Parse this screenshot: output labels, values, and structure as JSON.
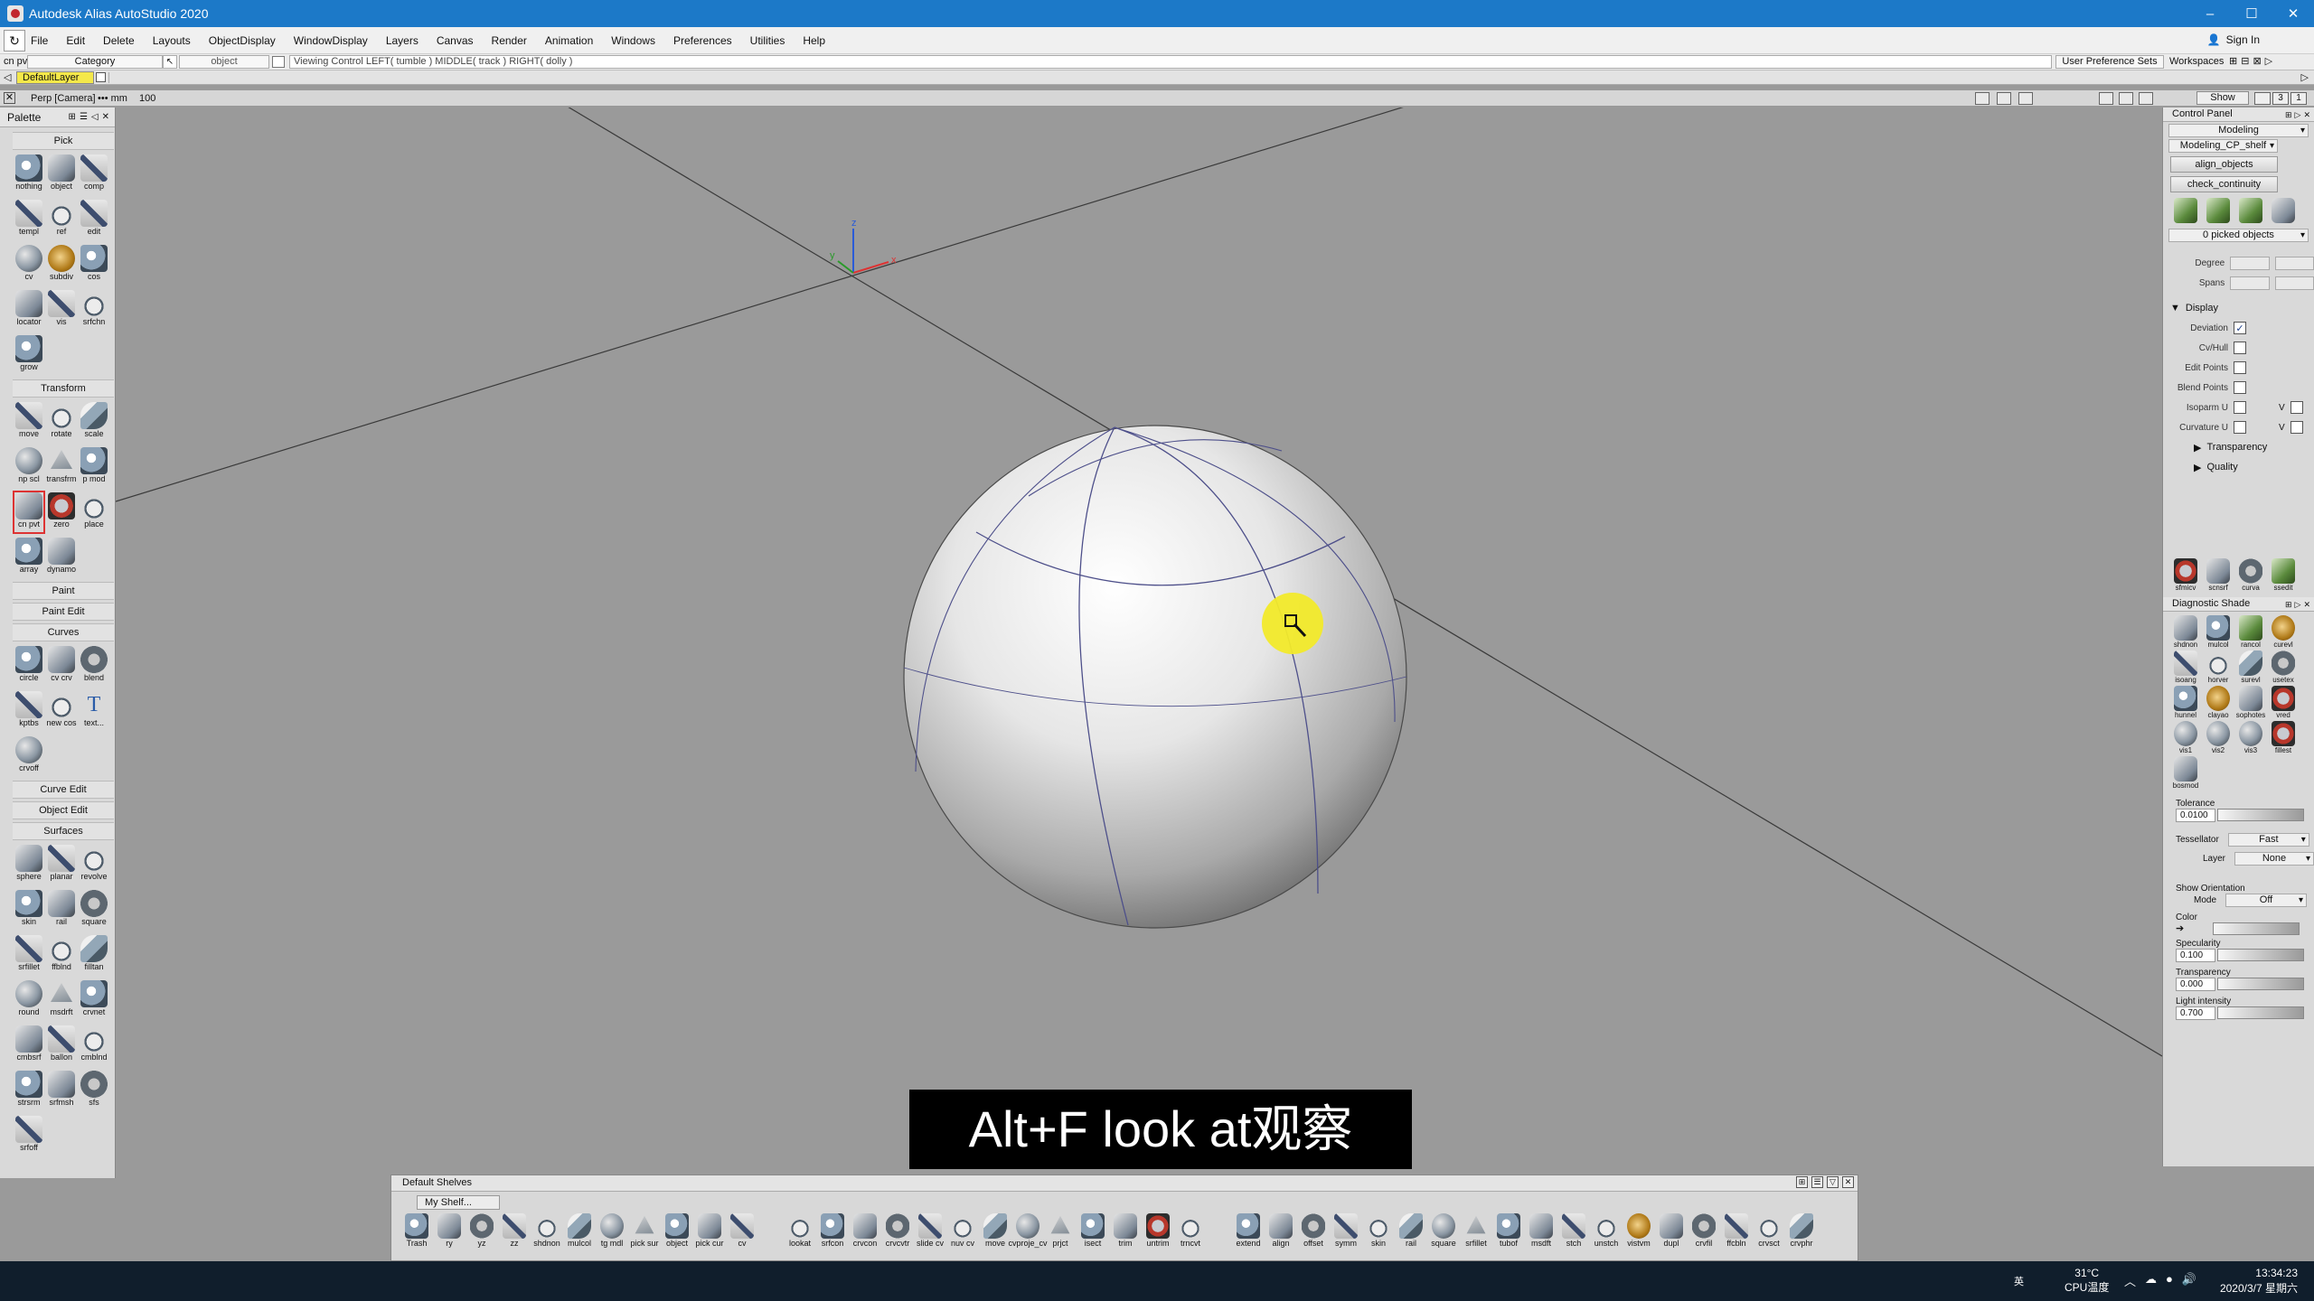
{
  "window": {
    "title": "Autodesk Alias AutoStudio 2020",
    "minimize": "–",
    "maximize": "☐",
    "close": "✕"
  },
  "menubar": {
    "items": [
      "File",
      "Edit",
      "Delete",
      "Layouts",
      "ObjectDisplay",
      "WindowDisplay",
      "Layers",
      "Canvas",
      "Render",
      "Animation",
      "Windows",
      "Preferences",
      "Utilities",
      "Help"
    ],
    "sign_in": "Sign In"
  },
  "controlbar": {
    "current_tool": "cn pvt",
    "category": "Category",
    "pick_mode": "object",
    "viewing_control": "Viewing Control   LEFT( tumble )   MIDDLE( track )   RIGHT( dolly )",
    "user_preference_sets": "User Preference Sets",
    "workspaces": "Workspaces"
  },
  "layerbar": {
    "default_layer": "DefaultLayer",
    "default_layer_color": "#f4e84a"
  },
  "viewbar": {
    "camera": "Perp [Camera]",
    "units": "••• mm",
    "zoom": "100",
    "show": "Show",
    "quick_views": [
      "1",
      "3"
    ]
  },
  "palette": {
    "title": "Palette",
    "sections": [
      {
        "name": "Pick",
        "tools": [
          "nothing",
          "object",
          "comp",
          "templ",
          "ref",
          "edit",
          "cv",
          "subdiv",
          "cos",
          "locator",
          "vis",
          "srfchn",
          "grow"
        ]
      },
      {
        "name": "Transform",
        "tools": [
          "move",
          "rotate",
          "scale",
          "np scl",
          "transfrm",
          "p mod",
          "cn pvt",
          "zero",
          "place",
          "array",
          "dynamo"
        ]
      },
      {
        "name": "Paint",
        "tools": []
      },
      {
        "name": "Paint Edit",
        "tools": []
      },
      {
        "name": "Curves",
        "tools": [
          "circle",
          "cv crv",
          "blend",
          "kptbs",
          "new cos",
          "text...",
          "crvoff"
        ]
      },
      {
        "name": "Curve Edit",
        "tools": []
      },
      {
        "name": "Object Edit",
        "tools": []
      },
      {
        "name": "Surfaces",
        "tools": [
          "sphere",
          "planar",
          "revolve",
          "skin",
          "rail",
          "square",
          "srfillet",
          "ffblnd",
          "filltan",
          "round",
          "msdrft",
          "crvnet",
          "cmbsrf",
          "ballon",
          "cmblnd",
          "strsrm",
          "srfmsh",
          "sfs",
          "srfoff"
        ]
      }
    ],
    "selected_tool": "cn pvt"
  },
  "viewport": {
    "background": "#9a9a9a",
    "axis_labels": {
      "x": "x",
      "y": "y",
      "z": "z"
    }
  },
  "subtitle": {
    "text": "Alt+F   look at观察"
  },
  "shelf": {
    "title": "Default Shelves",
    "tab": "My Shelf...",
    "tools": [
      "Trash",
      "ry",
      "yz",
      "zz",
      "shdnon",
      "mulcol",
      "tg mdl",
      "pick sur",
      "object",
      "pick cur",
      "cv",
      "lookat",
      "srfcon",
      "crvcon",
      "crvcvtr",
      "slide cv",
      "nuv cv",
      "move",
      "cvproje_cv",
      "prjct",
      "isect",
      "trim",
      "untrim",
      "trncvt",
      "extend",
      "align",
      "offset",
      "symm",
      "skin",
      "rail",
      "square",
      "srfillet",
      "tubof",
      "msdft",
      "stch",
      "unstch",
      "vistvm",
      "dupl",
      "crvfil",
      "ffcbln",
      "crvsct",
      "crvphr"
    ]
  },
  "control_panel": {
    "title": "Control Panel",
    "mode": "Modeling",
    "shelf": "Modeling_CP_shelf",
    "align_button": "align_objects",
    "check_button": "check_continuity",
    "picked": "0 picked objects",
    "degree_label": "Degree",
    "spans_label": "Spans",
    "display_section": "Display",
    "display_items": [
      {
        "label": "Deviation",
        "checked": true
      },
      {
        "label": "Cv/Hull",
        "checked": false
      },
      {
        "label": "Edit Points",
        "checked": false
      },
      {
        "label": "Blend Points",
        "checked": false
      },
      {
        "label": "Isoparm U",
        "checked": false,
        "v": "V"
      },
      {
        "label": "Curvature U",
        "checked": false,
        "v": "V"
      }
    ],
    "transparency_section": "Transparency",
    "quality_section": "Quality",
    "bottom_tools": [
      "sfmicv",
      "scnsrf",
      "curva",
      "ssedit"
    ],
    "diag_title": "Diagnostic Shade",
    "diag_tools": [
      "shdnon",
      "mulcol",
      "rancol",
      "curevl",
      "isoang",
      "horver",
      "surevl",
      "usetex",
      "hunnel",
      "clayao",
      "sophotes",
      "vred",
      "vis1",
      "vis2",
      "vis3",
      "fillest",
      "bosmod"
    ],
    "tolerance_label": "Tolerance",
    "tolerance_value": "0.0100",
    "tessellator_label": "Tessellator",
    "tessellator_value": "Fast",
    "layer_label": "Layer",
    "layer_value": "None",
    "show_orientation_label": "Show Orientation",
    "mode_label": "Mode",
    "mode_value": "Off",
    "color_label": "Color",
    "specularity_label": "Specularity",
    "specularity_value": "0.100",
    "transparency_label": "Transparency",
    "transparency_value": "0.000",
    "light_intensity_label": "Light intensity",
    "light_intensity_value": "0.700"
  },
  "taskbar": {
    "ime": "英",
    "temp": "31°C",
    "cpu": "CPU温度",
    "time": "13:34:23",
    "date": "2020/3/7 星期六"
  }
}
